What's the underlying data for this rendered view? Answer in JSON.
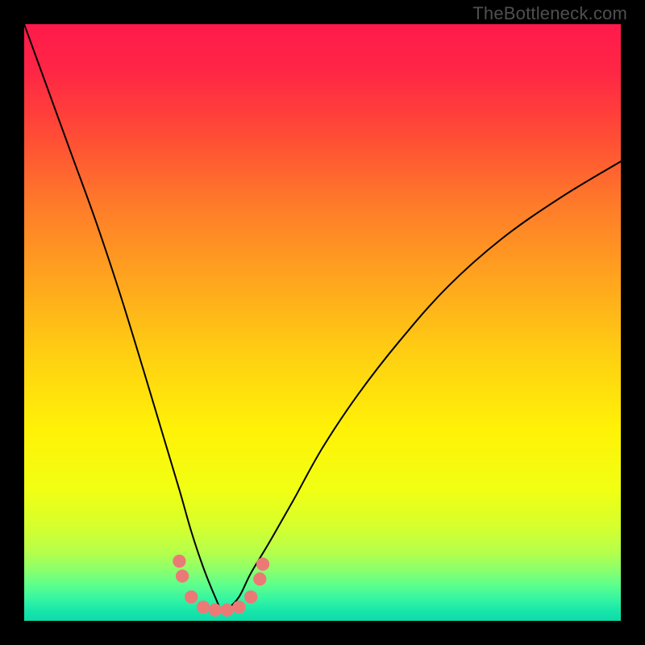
{
  "watermark": "TheBottleneck.com",
  "chart_data": {
    "type": "line",
    "title": "",
    "xlabel": "",
    "ylabel": "",
    "xlim": [
      0,
      100
    ],
    "ylim": [
      0,
      100
    ],
    "grid": false,
    "legend": false,
    "note": "V-shaped bottleneck curve over a vertical rainbow heat gradient (red→yellow→green). Y is ~percentage distance from optimal; minimum (~0) around x≈33.",
    "gradient_stops": [
      {
        "pos": 0.0,
        "color": "#ff1a4b"
      },
      {
        "pos": 0.08,
        "color": "#ff2745"
      },
      {
        "pos": 0.18,
        "color": "#ff4a36"
      },
      {
        "pos": 0.3,
        "color": "#ff7a2a"
      },
      {
        "pos": 0.42,
        "color": "#ffa21f"
      },
      {
        "pos": 0.55,
        "color": "#ffce12"
      },
      {
        "pos": 0.68,
        "color": "#fff207"
      },
      {
        "pos": 0.78,
        "color": "#f1ff13"
      },
      {
        "pos": 0.84,
        "color": "#d7ff2c"
      },
      {
        "pos": 0.885,
        "color": "#b7ff4a"
      },
      {
        "pos": 0.915,
        "color": "#8dff6b"
      },
      {
        "pos": 0.94,
        "color": "#5fff8c"
      },
      {
        "pos": 0.965,
        "color": "#34f5a2"
      },
      {
        "pos": 0.985,
        "color": "#17e6ab"
      },
      {
        "pos": 1.0,
        "color": "#0fdca9"
      }
    ],
    "series": [
      {
        "name": "bottleneck-curve",
        "x": [
          0,
          4,
          8,
          12,
          16,
          20,
          23,
          26,
          28,
          30,
          32,
          33,
          34,
          36,
          38,
          41,
          45,
          50,
          56,
          63,
          71,
          80,
          90,
          100
        ],
        "y": [
          100,
          89,
          78,
          67,
          55,
          42,
          32,
          22,
          15,
          9,
          4,
          2,
          2,
          4,
          8,
          13,
          20,
          29,
          38,
          47,
          56,
          64,
          71,
          77
        ]
      }
    ],
    "dots": {
      "name": "sample-markers",
      "color": "#eb7a77",
      "radius_pct": 1.1,
      "points": [
        {
          "x": 26.0,
          "y": 10.0
        },
        {
          "x": 26.5,
          "y": 7.5
        },
        {
          "x": 28.0,
          "y": 4.0
        },
        {
          "x": 30.0,
          "y": 2.3
        },
        {
          "x": 32.0,
          "y": 1.8
        },
        {
          "x": 34.0,
          "y": 1.8
        },
        {
          "x": 36.0,
          "y": 2.3
        },
        {
          "x": 38.0,
          "y": 4.0
        },
        {
          "x": 39.5,
          "y": 7.0
        },
        {
          "x": 40.0,
          "y": 9.5
        }
      ]
    }
  }
}
